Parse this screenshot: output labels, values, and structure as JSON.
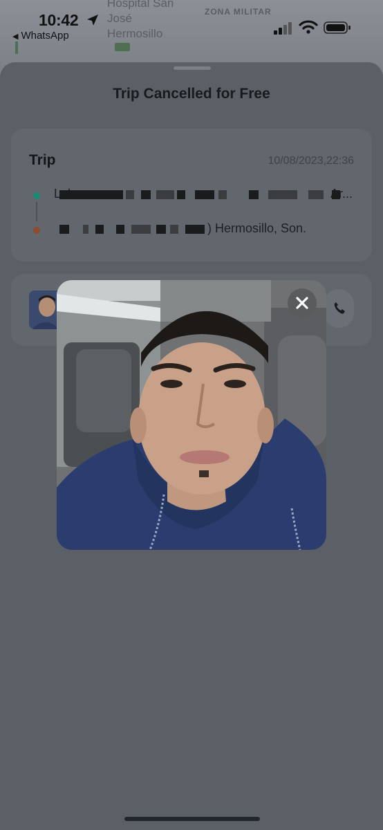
{
  "status_bar": {
    "time": "10:42",
    "back_app": "WhatsApp"
  },
  "map": {
    "label_hospital": "Hospital San José Hermosillo",
    "label_zona": "ZONA MILITAR"
  },
  "sheet": {
    "title": "Trip Cancelled for Free"
  },
  "trip": {
    "heading": "Trip",
    "datetime": "10/08/2023,22:36",
    "pickup_prefix": "Lab",
    "pickup_suffix": "Ar...",
    "dropoff_suffix": ") Hermosillo, Son."
  },
  "colors": {
    "pickup_dot": "#1a8a76",
    "dropoff_dot": "#8e4b2d",
    "backdrop": "#5d6168"
  },
  "icons": {
    "location_arrow": "location-arrow-icon",
    "close": "close-icon",
    "phone": "phone-icon"
  }
}
